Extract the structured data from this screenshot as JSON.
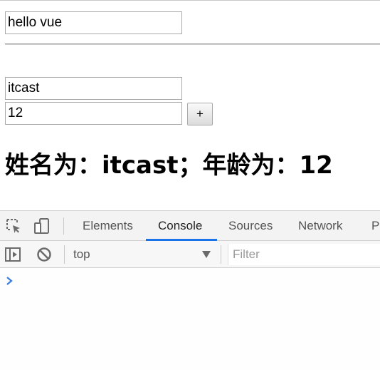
{
  "page": {
    "message_value": "hello vue",
    "name_value": "itcast",
    "age_value": "12",
    "increment_label": "+",
    "result_text": "姓名为：itcast；年龄为：12"
  },
  "devtools": {
    "tabs": [
      {
        "label": "Elements",
        "active": false
      },
      {
        "label": "Console",
        "active": true
      },
      {
        "label": "Sources",
        "active": false
      },
      {
        "label": "Network",
        "active": false
      },
      {
        "label": "Pe",
        "active": false
      }
    ],
    "toolbar": {
      "context": "top",
      "filter_placeholder": "Filter"
    },
    "icons": [
      "inspect-element-icon",
      "device-toolbar-icon",
      "show-sidebar-icon",
      "clear-console-icon",
      "dropdown-arrow-icon",
      "console-prompt-icon"
    ],
    "accent_color": "#1a73e8",
    "prompt_color": "#3b7ddd"
  }
}
